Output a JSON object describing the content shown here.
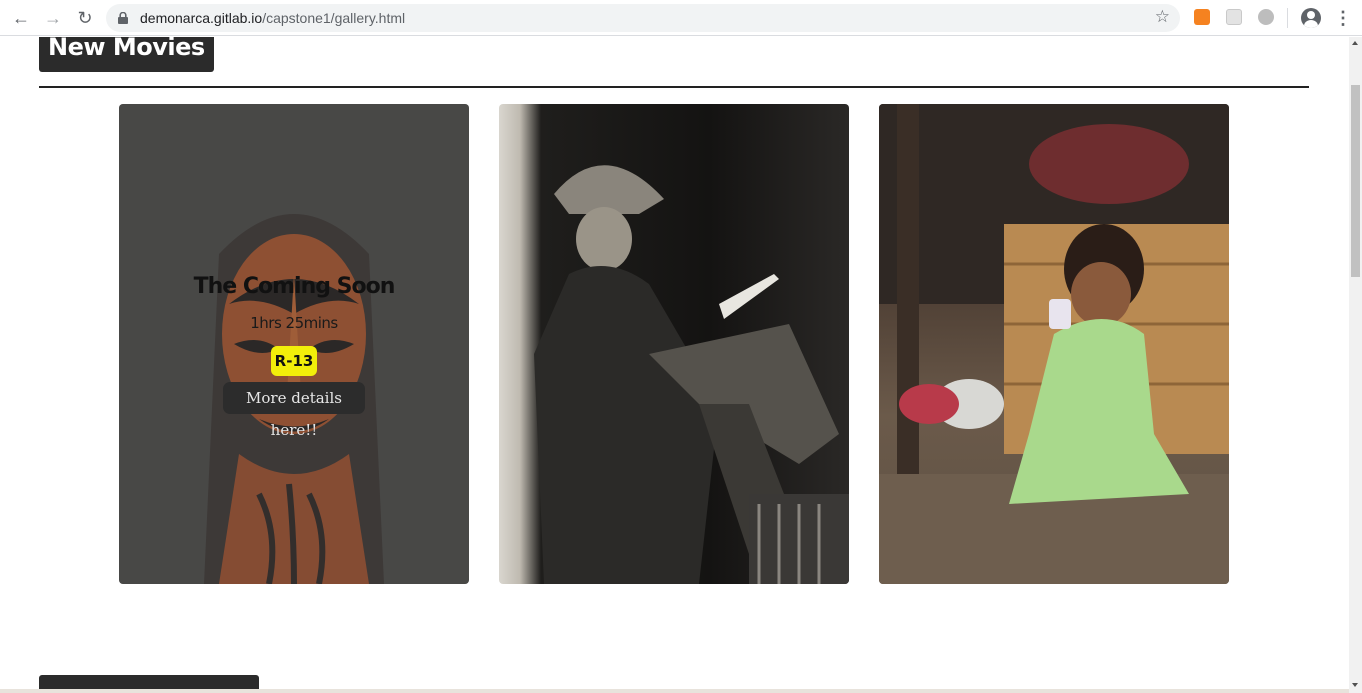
{
  "browser": {
    "url_host": "demonarca.gitlab.io",
    "url_path": "/capstone1/gallery.html",
    "icons": [
      "back-icon",
      "forward-icon",
      "reload-icon",
      "lock-icon",
      "star-icon",
      "extension-icon",
      "profile-icon",
      "menu-icon"
    ]
  },
  "sections": {
    "new_movies": "New Movies"
  },
  "cards": [
    {
      "title": "The Coming Soon",
      "duration": "1hrs 25mins",
      "rating": "R-13",
      "details_label": "More details here!!"
    }
  ],
  "colors": {
    "heading_bg": "#2b2b2b",
    "rating_badge": "#f2ee0a"
  }
}
